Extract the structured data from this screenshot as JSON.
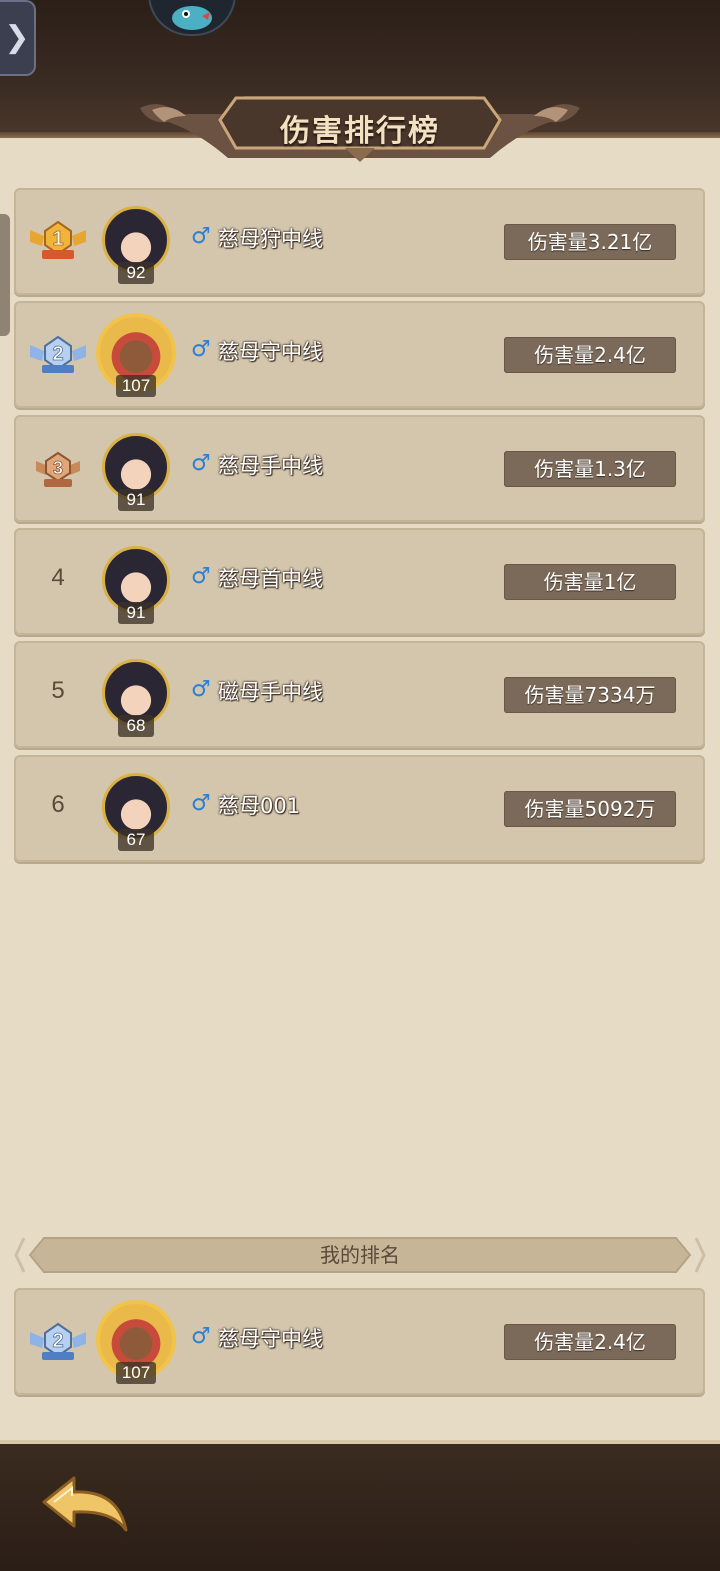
{
  "header": {
    "title": "伤害排行榜"
  },
  "rankings": [
    {
      "rank": "1",
      "level": "92",
      "name": "慈母狩中线",
      "damage": "伤害量3.21亿"
    },
    {
      "rank": "2",
      "level": "107",
      "name": "慈母守中线",
      "damage": "伤害量2.4亿"
    },
    {
      "rank": "3",
      "level": "91",
      "name": "慈母手中线",
      "damage": "伤害量1.3亿"
    },
    {
      "rank": "4",
      "level": "91",
      "name": "慈母首中线",
      "damage": "伤害量1亿"
    },
    {
      "rank": "5",
      "level": "68",
      "name": "磁母手中线",
      "damage": "伤害量7334万"
    },
    {
      "rank": "6",
      "level": "67",
      "name": "慈母001",
      "damage": "伤害量5092万"
    }
  ],
  "my_rank": {
    "label": "我的排名",
    "rank": "2",
    "level": "107",
    "name": "慈母守中线",
    "damage": "伤害量2.4亿"
  },
  "icons": {
    "gender": "male-icon",
    "back": "back-arrow-icon",
    "expand": "chevron-right-icon"
  },
  "colors": {
    "background": "#e6dbc5",
    "card": "#d4c6ad",
    "badge": "#7b6a59",
    "gold_medal": "#e7a531",
    "silver_medal": "#8fb3e6",
    "bronze_medal": "#c98a5a",
    "gender": "#2a7fd6"
  }
}
